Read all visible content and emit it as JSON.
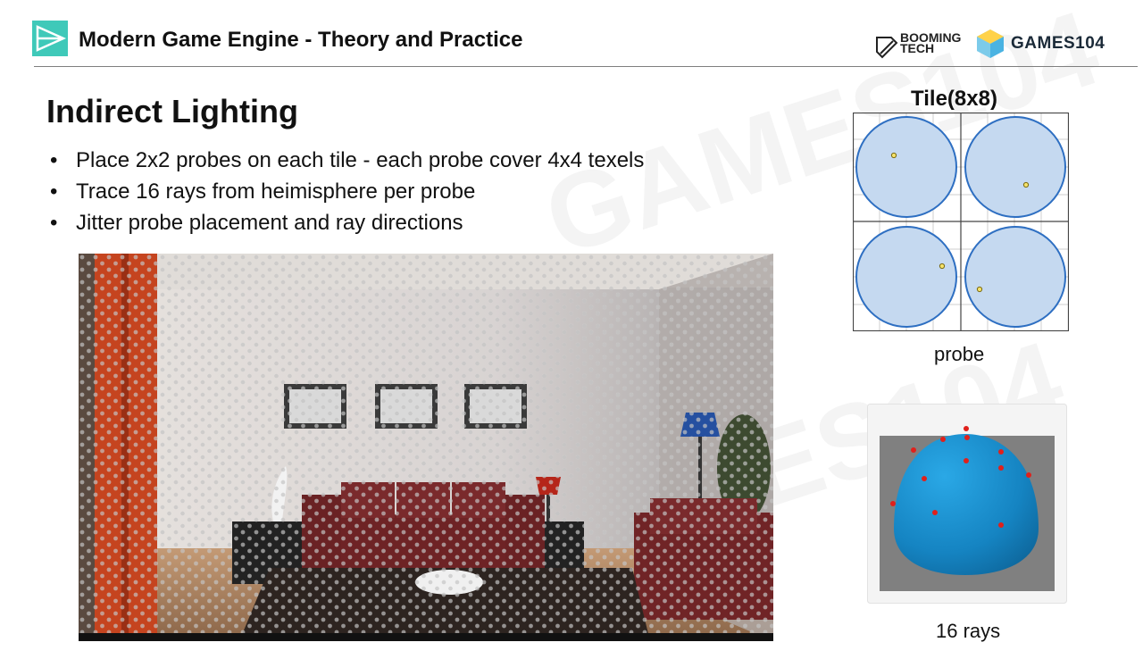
{
  "header": {
    "course_title": "Modern Game Engine - Theory and Practice",
    "brand_booming": "BOOMING\nTECH",
    "brand_games": "GAMES104"
  },
  "slide": {
    "title": "Indirect Lighting",
    "bullets": [
      "Place 2x2 probes on each tile - each probe cover 4x4 texels",
      "Trace 16 rays from heimisphere per probe",
      "Jitter probe placement and ray directions"
    ]
  },
  "figures": {
    "tile_caption": "Tile(8x8)",
    "probe_caption": "probe",
    "rays_caption": "16 rays"
  },
  "colors": {
    "accent": "#3fc9b9",
    "probe_fill": "#c5d9f0",
    "probe_stroke": "#2e6fc2",
    "hemisphere": "#1a87c4",
    "ray_dot": "#e0201b"
  }
}
